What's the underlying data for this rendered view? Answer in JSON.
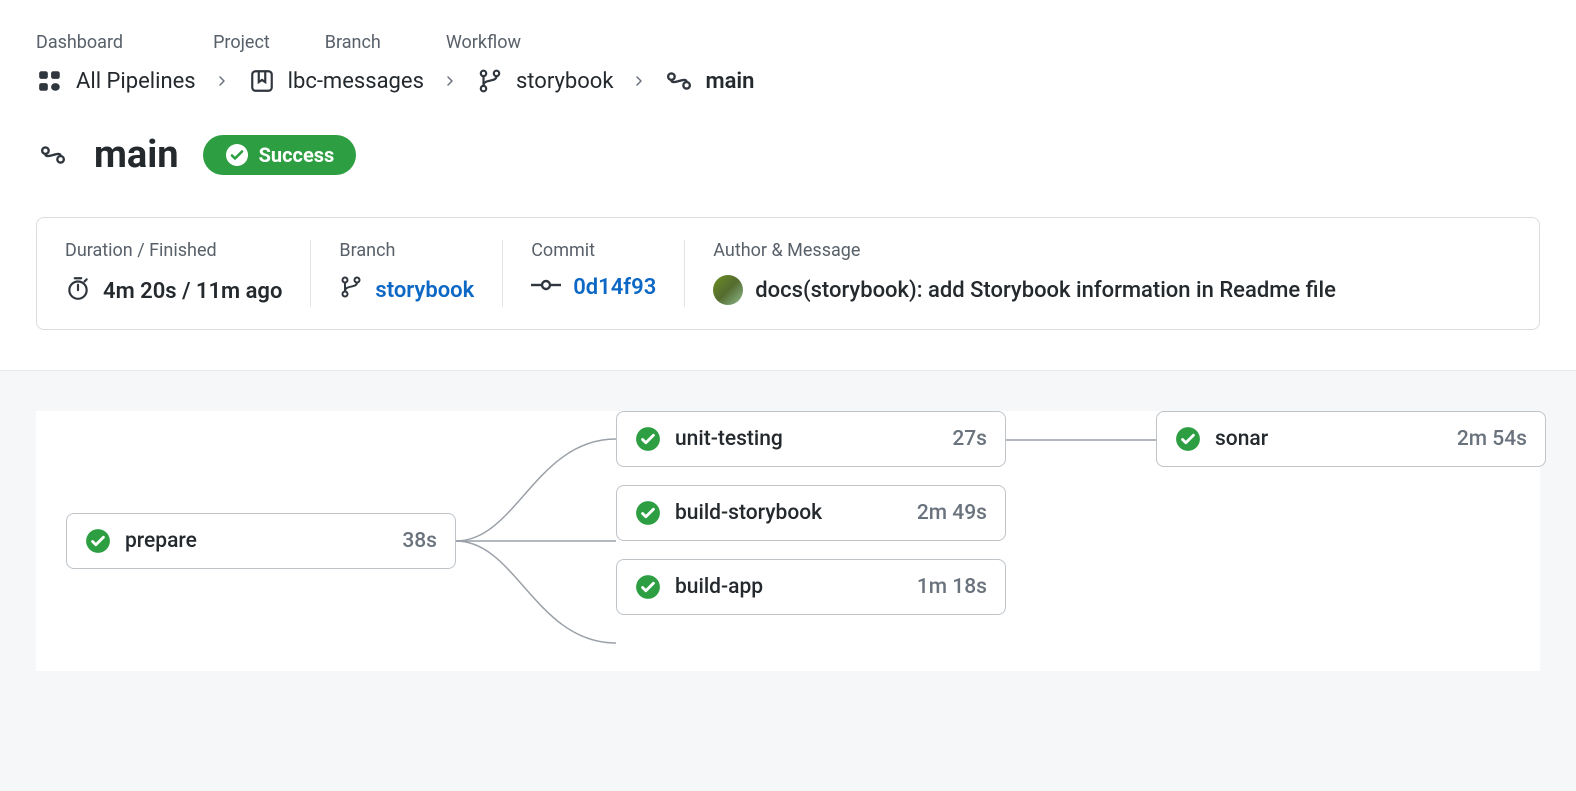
{
  "breadcrumb": {
    "labels": {
      "dashboard": "Dashboard",
      "project": "Project",
      "branch": "Branch",
      "workflow": "Workflow"
    },
    "dashboard": "All Pipelines",
    "project": "lbc-messages",
    "branch": "storybook",
    "workflow": "main"
  },
  "title": {
    "name": "main",
    "status": "Success"
  },
  "info": {
    "duration_label": "Duration / Finished",
    "duration_value": "4m 20s / 11m ago",
    "branch_label": "Branch",
    "branch_value": "storybook",
    "commit_label": "Commit",
    "commit_value": "0d14f93",
    "author_label": "Author & Message",
    "author_message": "docs(storybook): add Storybook information in Readme file"
  },
  "jobs": {
    "prepare": {
      "name": "prepare",
      "time": "38s"
    },
    "unit_testing": {
      "name": "unit-testing",
      "time": "27s"
    },
    "build_storybook": {
      "name": "build-storybook",
      "time": "2m 49s"
    },
    "build_app": {
      "name": "build-app",
      "time": "1m 18s"
    },
    "sonar": {
      "name": "sonar",
      "time": "2m 54s"
    }
  },
  "colors": {
    "success": "#2e9e42",
    "link": "#0d68c5"
  }
}
